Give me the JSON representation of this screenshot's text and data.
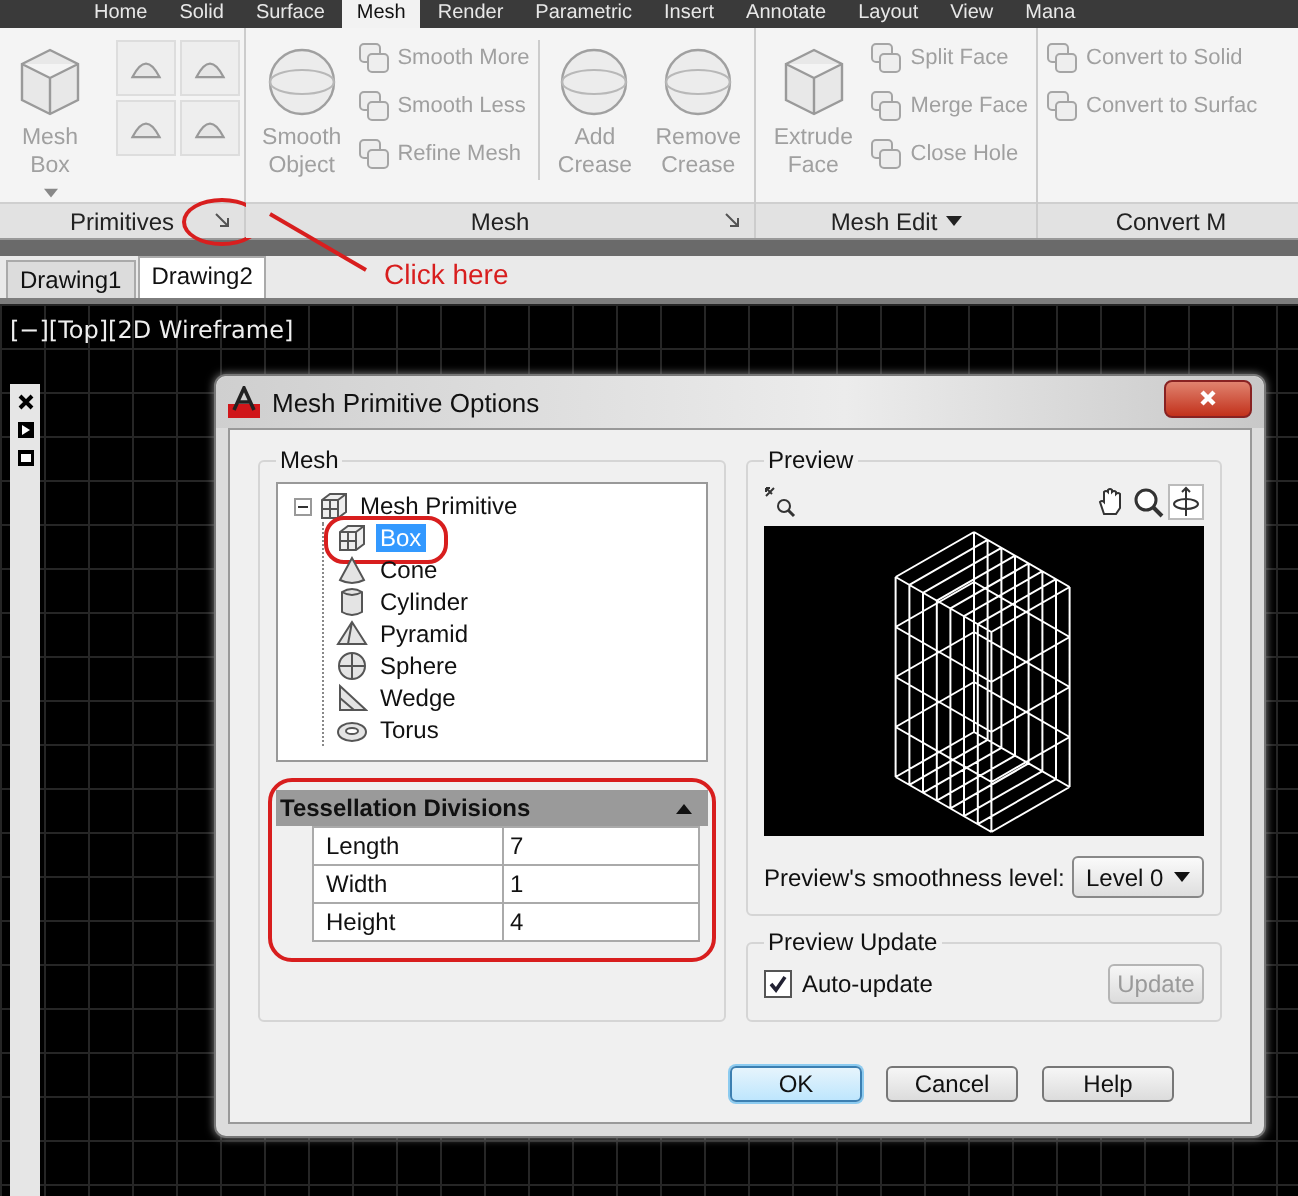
{
  "ribbon_tabs": [
    {
      "label": "Home",
      "selected": false
    },
    {
      "label": "Solid",
      "selected": false
    },
    {
      "label": "Surface",
      "selected": false
    },
    {
      "label": "Mesh",
      "selected": true
    },
    {
      "label": "Render",
      "selected": false
    },
    {
      "label": "Parametric",
      "selected": false
    },
    {
      "label": "Insert",
      "selected": false
    },
    {
      "label": "Annotate",
      "selected": false
    },
    {
      "label": "Layout",
      "selected": false
    },
    {
      "label": "View",
      "selected": false
    },
    {
      "label": "Mana",
      "selected": false
    }
  ],
  "ribbon_panels": [
    {
      "title": "Primitives",
      "launcher": true,
      "items": [
        {
          "kind": "large",
          "label": "Mesh Box",
          "dropdown": true
        },
        {
          "kind": "icon"
        },
        {
          "kind": "icon"
        },
        {
          "kind": "icon"
        },
        {
          "kind": "icon"
        }
      ]
    },
    {
      "title": "Mesh",
      "launcher": true,
      "items": [
        {
          "kind": "large",
          "label": "Smooth Object"
        },
        {
          "kind": "small",
          "label": "Smooth More"
        },
        {
          "kind": "small",
          "label": "Smooth Less"
        },
        {
          "kind": "small",
          "label": "Refine Mesh"
        },
        {
          "kind": "large",
          "label": "Add Crease"
        },
        {
          "kind": "large",
          "label": "Remove Crease"
        }
      ]
    },
    {
      "title": "Mesh Edit",
      "menu": true,
      "items": [
        {
          "kind": "large",
          "label": "Extrude Face"
        },
        {
          "kind": "small",
          "label": "Split Face"
        },
        {
          "kind": "small",
          "label": "Merge Face"
        },
        {
          "kind": "small",
          "label": "Close Hole"
        }
      ]
    },
    {
      "title": "Convert M",
      "items": [
        {
          "kind": "small",
          "label": "Convert to Solid"
        },
        {
          "kind": "small",
          "label": "Convert to Surfac"
        }
      ]
    }
  ],
  "annotation": {
    "text": "Click here"
  },
  "file_tabs": [
    {
      "label": "Drawing1",
      "selected": false
    },
    {
      "label": "Drawing2",
      "selected": true
    }
  ],
  "viewport": {
    "label": "[−][Top][2D Wireframe]"
  },
  "dialog": {
    "title": "Mesh Primitive Options",
    "mesh_group": {
      "label": "Mesh",
      "tree": {
        "label": "Mesh Primitive",
        "expanded": true,
        "children": [
          {
            "label": "Box",
            "kind": "box",
            "selected": true
          },
          {
            "label": "Cone",
            "kind": "cone",
            "selected": false
          },
          {
            "label": "Cylinder",
            "kind": "cylinder",
            "selected": false
          },
          {
            "label": "Pyramid",
            "kind": "pyramid",
            "selected": false
          },
          {
            "label": "Sphere",
            "kind": "sphere",
            "selected": false
          },
          {
            "label": "Wedge",
            "kind": "wedge",
            "selected": false
          },
          {
            "label": "Torus",
            "kind": "torus",
            "selected": false
          }
        ]
      },
      "properties": {
        "title": "Tessellation Divisions",
        "expanded": true,
        "rows": [
          {
            "name": "Length",
            "value": "7"
          },
          {
            "name": "Width",
            "value": "1"
          },
          {
            "name": "Height",
            "value": "4"
          }
        ]
      }
    },
    "preview_group": {
      "label": "Preview",
      "smoothness_label": "Preview's smoothness level:",
      "smoothness_value": "Level 0"
    },
    "update_group": {
      "label": "Preview Update",
      "auto_update": {
        "label": "Auto-update",
        "checked": true
      },
      "update_button": {
        "label": "Update",
        "disabled": true
      }
    },
    "buttons": [
      {
        "label": "OK",
        "default": true
      },
      {
        "label": "Cancel",
        "default": false
      },
      {
        "label": "Help",
        "default": false
      }
    ]
  }
}
